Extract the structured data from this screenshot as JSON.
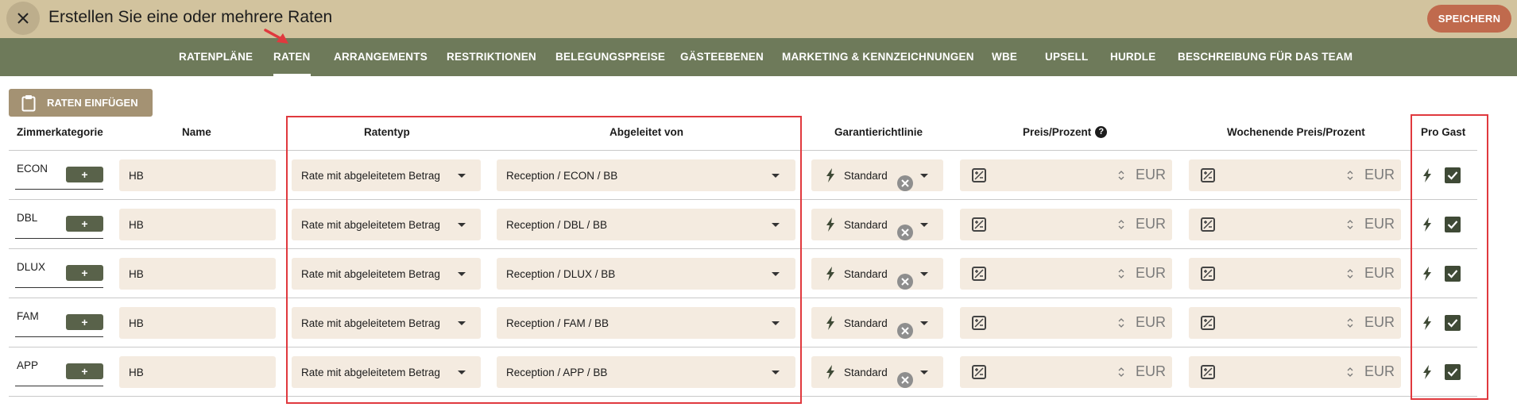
{
  "header": {
    "title": "Erstellen Sie eine oder mehrere Raten",
    "save_label": "SPEICHERN"
  },
  "tabs": [
    {
      "label": "RATENPLÄNE"
    },
    {
      "label": "RATEN"
    },
    {
      "label": "ARRANGEMENTS"
    },
    {
      "label": "RESTRIKTIONEN"
    },
    {
      "label": "BELEGUNGSPREISE"
    },
    {
      "label": "GÄSTEEBENEN"
    },
    {
      "label": "MARKETING & KENNZEICHNUNGEN"
    },
    {
      "label": "WBE"
    },
    {
      "label": "UPSELL"
    },
    {
      "label": "HURDLE"
    },
    {
      "label": "BESCHREIBUNG FÜR DAS TEAM"
    }
  ],
  "toolbar": {
    "paste_label": "RATEN EINFÜGEN"
  },
  "columns": {
    "room": "Zimmerkategorie",
    "name": "Name",
    "rate_type": "Ratentyp",
    "derived": "Abgeleitet von",
    "guarantee": "Garantierichtlinie",
    "price": "Preis/Prozent",
    "weekend": "Wochenende Preis/Prozent",
    "per_guest": "Pro Gast"
  },
  "common": {
    "add_label": "+",
    "currency": "EUR"
  },
  "rows": [
    {
      "room": "ECON",
      "name": "HB",
      "rate_type": "Rate mit abgeleitetem Betrag",
      "derived": "Reception / ECON / BB",
      "guarantee": "Standard"
    },
    {
      "room": "DBL",
      "name": "HB",
      "rate_type": "Rate mit abgeleitetem Betrag",
      "derived": "Reception / DBL / BB",
      "guarantee": "Standard"
    },
    {
      "room": "DLUX",
      "name": "HB",
      "rate_type": "Rate mit abgeleitetem Betrag",
      "derived": "Reception / DLUX / BB",
      "guarantee": "Standard"
    },
    {
      "room": "FAM",
      "name": "HB",
      "rate_type": "Rate mit abgeleitetem Betrag",
      "derived": "Reception / FAM / BB",
      "guarantee": "Standard"
    },
    {
      "room": "APP",
      "name": "HB",
      "rate_type": "Rate mit abgeleitetem Betrag",
      "derived": "Reception / APP / BB",
      "guarantee": "Standard"
    }
  ],
  "colors": {
    "topbar": "#d2c39e",
    "navbar": "#6e7a5a",
    "save": "#c06a4d",
    "field": "#f4ebe0",
    "highlight": "#e0393e"
  }
}
